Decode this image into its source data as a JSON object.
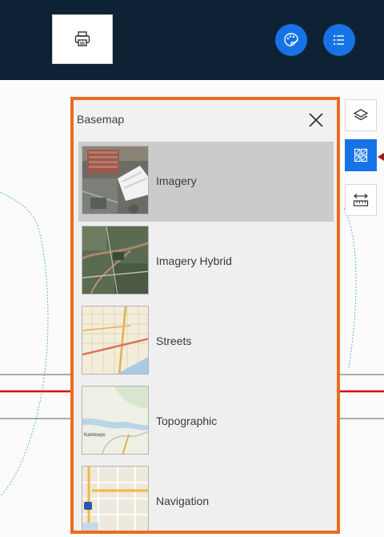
{
  "header": {
    "print_button": {
      "icon": "printer-icon"
    },
    "theme_button": {
      "icon": "palette-icon"
    },
    "list_button": {
      "icon": "list-icon"
    }
  },
  "toolbar": {
    "tools": [
      {
        "name": "layers",
        "icon": "layers-icon",
        "state": "default"
      },
      {
        "name": "basemap-gallery",
        "icon": "basemap-gallery-icon",
        "state": "active"
      },
      {
        "name": "measure",
        "icon": "measure-icon",
        "state": "default"
      }
    ]
  },
  "panel": {
    "title": "Basemap",
    "close_icon": "close-icon",
    "items": [
      {
        "label": "Imagery",
        "selected": true
      },
      {
        "label": "Imagery Hybrid",
        "selected": false
      },
      {
        "label": "Streets",
        "selected": false
      },
      {
        "label": "Topographic",
        "selected": false
      },
      {
        "label": "Navigation",
        "selected": false
      }
    ]
  },
  "thumbnails": {
    "topographic_city": "Kamloops"
  },
  "colors": {
    "header_bg": "#0e2235",
    "accent_blue": "#1573e6",
    "panel_border": "#e86d1f",
    "selected_item_bg": "#cbcbcb",
    "map_road_red": "#e10000",
    "map_pointer": "#9b1c1c"
  }
}
